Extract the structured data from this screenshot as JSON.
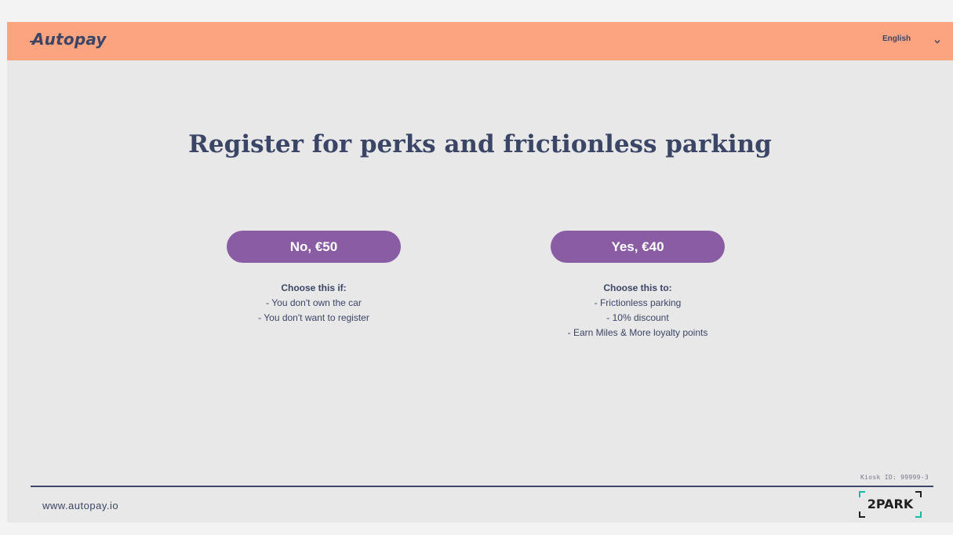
{
  "header": {
    "logo": "Autopay",
    "language": {
      "selected": "English",
      "icon": "chevron-down-icon"
    }
  },
  "main": {
    "title": "Register for perks and frictionless parking",
    "options": [
      {
        "button_label": "No, €50",
        "heading": "Choose this if:",
        "lines": [
          "- You don't own the car",
          "- You don't want to register"
        ]
      },
      {
        "button_label": "Yes, €40",
        "heading": "Choose this to:",
        "lines": [
          "- Frictionless parking",
          "- 10% discount",
          "- Earn Miles & More loyalty points"
        ]
      }
    ]
  },
  "footer": {
    "kiosk_id": "Kiosk ID: 99999-3",
    "url": "www.autopay.io",
    "partner_logo": "2PARK"
  },
  "colors": {
    "header_bg": "#fca47f",
    "page_bg": "#e8e8e8",
    "button_bg": "#8a5ca3",
    "text": "#3b4566"
  }
}
